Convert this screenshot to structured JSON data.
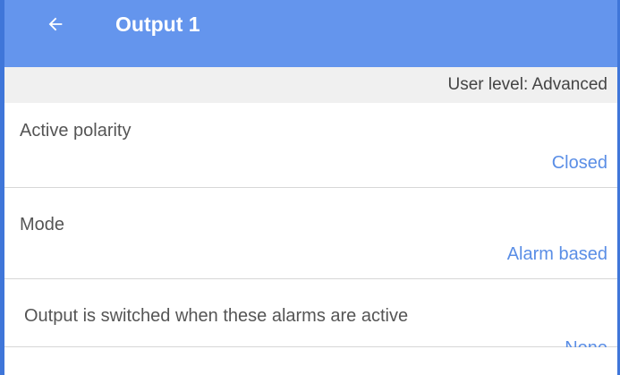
{
  "header": {
    "title": "Output 1",
    "back_icon": "arrow-left-icon"
  },
  "user_level": {
    "text": "User level: Advanced"
  },
  "settings": [
    {
      "label": "Active polarity",
      "value": "Closed"
    },
    {
      "label": "Mode",
      "value": "Alarm based"
    },
    {
      "label": "Output is switched when these alarms are active",
      "value": "None"
    }
  ],
  "colors": {
    "app_bar": "#6495ed",
    "accent_value": "#5a8ee6",
    "subheader_bg": "#f0f0f0",
    "label_text": "#555555"
  }
}
